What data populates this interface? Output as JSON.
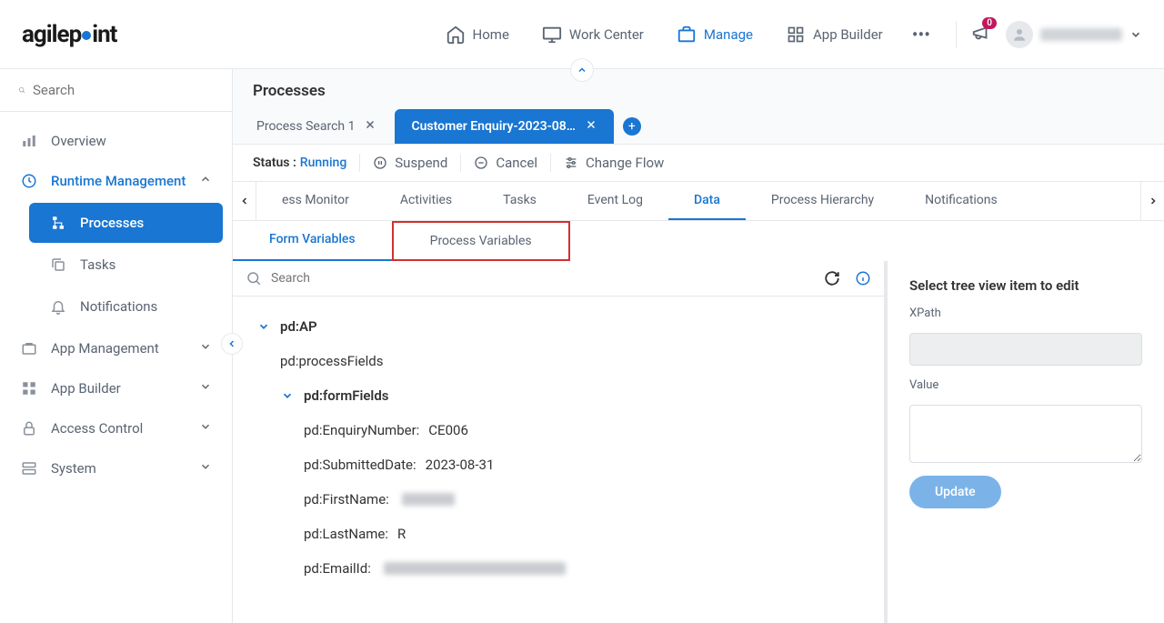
{
  "header": {
    "logo_prefix": "agilep",
    "logo_suffix": "int",
    "nav": [
      {
        "label": "Home",
        "icon": "home"
      },
      {
        "label": "Work Center",
        "icon": "monitor"
      },
      {
        "label": "Manage",
        "icon": "briefcase",
        "active": true
      },
      {
        "label": "App Builder",
        "icon": "grid"
      }
    ],
    "notification_count": "0",
    "user_name": ""
  },
  "sidebar": {
    "search_placeholder": "Search",
    "items": [
      {
        "label": "Overview",
        "icon": "chart"
      },
      {
        "label": "Runtime Management",
        "icon": "clock",
        "expanded": true,
        "children": [
          {
            "label": "Processes",
            "icon": "flow",
            "active": true
          },
          {
            "label": "Tasks",
            "icon": "copy"
          },
          {
            "label": "Notifications",
            "icon": "bell"
          }
        ]
      },
      {
        "label": "App Management",
        "icon": "briefcase-sm"
      },
      {
        "label": "App Builder",
        "icon": "grid-sm"
      },
      {
        "label": "Access Control",
        "icon": "lock"
      },
      {
        "label": "System",
        "icon": "server"
      }
    ]
  },
  "main": {
    "title": "Processes",
    "tabs": [
      {
        "label": "Process Search 1",
        "active": false
      },
      {
        "label": "Customer Enquiry-2023-08…",
        "active": true
      }
    ],
    "toolbar": {
      "status_label": "Status :",
      "status_value": "Running",
      "suspend": "Suspend",
      "cancel": "Cancel",
      "change_flow": "Change Flow"
    },
    "subtabs": {
      "items": [
        "ess Monitor",
        "Activities",
        "Tasks",
        "Event Log",
        "Data",
        "Process Hierarchy",
        "Notifications"
      ],
      "active": "Data"
    },
    "varsubtabs": {
      "form_variables": "Form Variables",
      "process_variables": "Process Variables",
      "active": "Form Variables"
    },
    "tree_search_placeholder": "Search",
    "tree": {
      "root": "pd:AP",
      "processFields": "pd:processFields",
      "formFields": "pd:formFields",
      "leaves": [
        {
          "key": "pd:EnquiryNumber:",
          "value": "CE006"
        },
        {
          "key": "pd:SubmittedDate:",
          "value": "2023-08-31"
        },
        {
          "key": "pd:FirstName:",
          "value": "",
          "blurred": true,
          "blur_w": 58
        },
        {
          "key": "pd:LastName:",
          "value": "R"
        },
        {
          "key": "pd:EmailId:",
          "value": "",
          "blurred": true,
          "blur_w": 200
        }
      ]
    },
    "edit": {
      "title": "Select tree view item to edit",
      "xpath_label": "XPath",
      "xpath_value": "",
      "value_label": "Value",
      "value_value": "",
      "update": "Update"
    }
  }
}
